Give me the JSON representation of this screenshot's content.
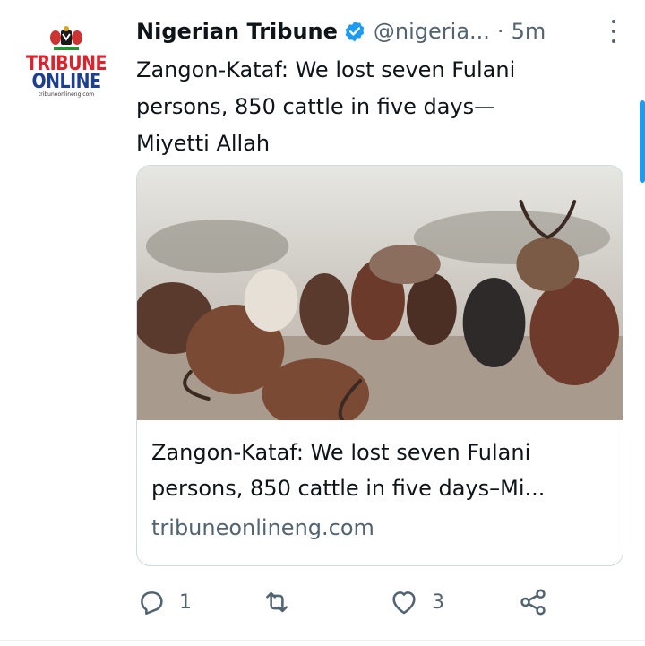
{
  "author": {
    "name": "Nigerian Tribune",
    "handle": "@nigeria...",
    "separator": "·",
    "time": "5m",
    "avatar_top": "TRIBUNE",
    "avatar_bottom": "ONLINE",
    "avatar_url": "tribuneonlineng.com"
  },
  "tweet": {
    "text": "Zangon-Kataf: We lost seven Fulani\npersons, 850 cattle in five days—\nMiyetti   Allah"
  },
  "card": {
    "title": "Zangon-Kataf: We lost seven Fulani persons, 850 cattle in five days–Mi...",
    "domain": "tribuneonlineng.com",
    "image_icon": "cattle-herd-photo"
  },
  "actions": {
    "replies": "1",
    "retweets": "",
    "likes": "3"
  },
  "colors": {
    "text": "#0f1419",
    "muted": "#536471",
    "verified": "#1d9bf0",
    "border": "#cfd9de",
    "brand_red": "#d9232d",
    "brand_blue": "#1d3f8f"
  }
}
